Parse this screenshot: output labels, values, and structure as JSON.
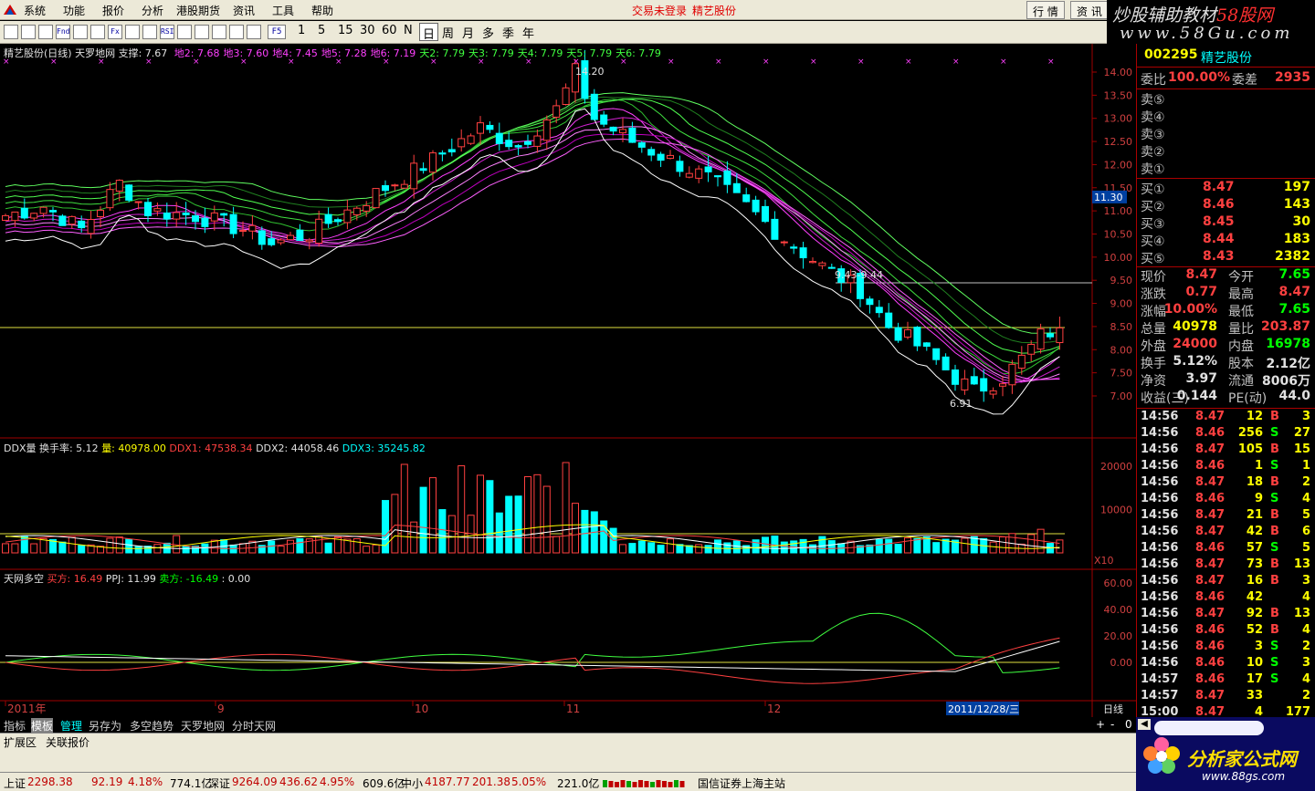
{
  "menu": {
    "items": [
      "系统",
      "功能",
      "报价",
      "分析",
      "港股期货",
      "资讯",
      "工具",
      "帮助"
    ],
    "trade_status": "交易未登录",
    "stock_name": "精艺股份",
    "right_buttons": [
      "行 情",
      "资 讯"
    ]
  },
  "brand_top": {
    "line1_a": "炒股辅助教材",
    "line1_b": "58股网",
    "line2": "www.58Gu.com"
  },
  "toolbar": {
    "icons": [
      "kline-tool-icon",
      "line-tool-icon",
      "chart-tool-icon",
      "fund-icon",
      "info-icon",
      "bars-icon",
      "fx-icon",
      "grid-icon",
      "sort-icon",
      "rsi-icon",
      "target-icon",
      "cursor-icon",
      "move-icon",
      "refresh-icon",
      "zoom-icon"
    ],
    "icon_labels": [
      "",
      "",
      "",
      "Fnd",
      "",
      "",
      "Fx",
      "",
      "",
      "RSI",
      "",
      "",
      "",
      "",
      ""
    ],
    "f5": "F5",
    "periods": [
      "1",
      "5",
      "15",
      "30",
      "60",
      "N",
      "日",
      "周",
      "月",
      "多",
      "季",
      "年"
    ],
    "active_period": "日"
  },
  "main_chart": {
    "header_title": "精艺股份(日线)",
    "indicator_name": "天罗地网",
    "support_label": "支撑: 7.67",
    "lines": [
      {
        "label": "地2: 7.68",
        "color": "#ff40ff"
      },
      {
        "label": "地3: 7.60",
        "color": "#ff40ff"
      },
      {
        "label": "地4: 7.45",
        "color": "#ff40ff"
      },
      {
        "label": "地5: 7.28",
        "color": "#ff40ff"
      },
      {
        "label": "地6: 7.19",
        "color": "#ff40ff"
      },
      {
        "label": "天2: 7.79",
        "color": "#40ff40"
      },
      {
        "label": "天3: 7.79",
        "color": "#40ff40"
      },
      {
        "label": "天4: 7.79",
        "color": "#40ff40"
      },
      {
        "label": "天5: 7.79",
        "color": "#40ff40"
      },
      {
        "label": "天6: 7.79",
        "color": "#40ff40"
      }
    ],
    "high_annotation": "14.20",
    "low_annotation": "6.91",
    "range_annotation": "9.43-9.44",
    "price_ticks": [
      "14.00",
      "13.50",
      "13.00",
      "12.50",
      "12.00",
      "11.50",
      "11.00",
      "10.50",
      "10.00",
      "9.50",
      "9.00",
      "8.50",
      "8.00",
      "7.50",
      "7.00"
    ],
    "current_price_tag": "11.30"
  },
  "volume_chart": {
    "name": "DDX量",
    "turnover": "换手率: 5.12",
    "volume": "量: 40978.00",
    "ddx1": "DDX1: 47538.34",
    "ddx2": "DDX2: 44058.46",
    "ddx3": "DDX3: 35245.82",
    "ticks": [
      "20000",
      "10000"
    ],
    "unit": "X10"
  },
  "osc_chart": {
    "name": "天网多空",
    "buy": "买方: 16.49",
    "ppj": "PPJ: 11.99",
    "sell": "卖方: -16.49",
    "tail": ": 0.00",
    "ticks": [
      "60.00",
      "40.00",
      "20.00",
      "0.00"
    ]
  },
  "date_axis": {
    "labels": [
      "2011年",
      "9",
      "10",
      "11",
      "12"
    ],
    "cursor_date": "2011/12/28/三",
    "period_label": "日线"
  },
  "right_panel": {
    "code": "002295",
    "name": "精艺股份",
    "weibi_label": "委比",
    "weibi_value": "100.00%",
    "weicha_label": "委差",
    "weicha_value": "2935",
    "sells": [
      {
        "label": "卖⑤",
        "price": "",
        "vol": ""
      },
      {
        "label": "卖④",
        "price": "",
        "vol": ""
      },
      {
        "label": "卖③",
        "price": "",
        "vol": ""
      },
      {
        "label": "卖②",
        "price": "",
        "vol": ""
      },
      {
        "label": "卖①",
        "price": "",
        "vol": ""
      }
    ],
    "buys": [
      {
        "label": "买①",
        "price": "8.47",
        "vol": "197"
      },
      {
        "label": "买②",
        "price": "8.46",
        "vol": "143"
      },
      {
        "label": "买③",
        "price": "8.45",
        "vol": "30"
      },
      {
        "label": "买④",
        "price": "8.44",
        "vol": "183"
      },
      {
        "label": "买⑤",
        "price": "8.43",
        "vol": "2382"
      }
    ],
    "stats": [
      {
        "l1": "现价",
        "v1": "8.47",
        "c1": "up",
        "l2": "今开",
        "v2": "7.65",
        "c2": "dn"
      },
      {
        "l1": "涨跌",
        "v1": "0.77",
        "c1": "up",
        "l2": "最高",
        "v2": "8.47",
        "c2": "up"
      },
      {
        "l1": "涨幅",
        "v1": "10.00%",
        "c1": "up",
        "l2": "最低",
        "v2": "7.65",
        "c2": "dn"
      },
      {
        "l1": "总量",
        "v1": "40978",
        "c1": "yel",
        "l2": "量比",
        "v2": "203.87",
        "c2": "up"
      },
      {
        "l1": "外盘",
        "v1": "24000",
        "c1": "up",
        "l2": "内盘",
        "v2": "16978",
        "c2": "dn"
      },
      {
        "l1": "换手",
        "v1": "5.12%",
        "c1": "wht",
        "l2": "股本",
        "v2": "2.12亿",
        "c2": "wht"
      },
      {
        "l1": "净资",
        "v1": "3.97",
        "c1": "wht",
        "l2": "流通",
        "v2": "8006万",
        "c2": "wht"
      },
      {
        "l1": "收益(三)",
        "v1": "0.144",
        "c1": "wht",
        "l2": "PE(动)",
        "v2": "44.0",
        "c2": "wht"
      }
    ],
    "ticks": [
      {
        "time": "14:56",
        "price": "8.47",
        "vol": "12",
        "side": "B",
        "n": "3"
      },
      {
        "time": "14:56",
        "price": "8.46",
        "vol": "256",
        "side": "S",
        "n": "27"
      },
      {
        "time": "14:56",
        "price": "8.47",
        "vol": "105",
        "side": "B",
        "n": "15"
      },
      {
        "time": "14:56",
        "price": "8.46",
        "vol": "1",
        "side": "S",
        "n": "1"
      },
      {
        "time": "14:56",
        "price": "8.47",
        "vol": "18",
        "side": "B",
        "n": "2"
      },
      {
        "time": "14:56",
        "price": "8.46",
        "vol": "9",
        "side": "S",
        "n": "4"
      },
      {
        "time": "14:56",
        "price": "8.47",
        "vol": "21",
        "side": "B",
        "n": "5"
      },
      {
        "time": "14:56",
        "price": "8.47",
        "vol": "42",
        "side": "B",
        "n": "6"
      },
      {
        "time": "14:56",
        "price": "8.46",
        "vol": "57",
        "side": "S",
        "n": "5"
      },
      {
        "time": "14:56",
        "price": "8.47",
        "vol": "73",
        "side": "B",
        "n": "13"
      },
      {
        "time": "14:56",
        "price": "8.47",
        "vol": "16",
        "side": "B",
        "n": "3"
      },
      {
        "time": "14:56",
        "price": "8.46",
        "vol": "42",
        "side": "",
        "n": "4"
      },
      {
        "time": "14:56",
        "price": "8.47",
        "vol": "92",
        "side": "B",
        "n": "13"
      },
      {
        "time": "14:56",
        "price": "8.46",
        "vol": "52",
        "side": "B",
        "n": "4"
      },
      {
        "time": "14:56",
        "price": "8.46",
        "vol": "3",
        "side": "S",
        "n": "2"
      },
      {
        "time": "14:56",
        "price": "8.46",
        "vol": "10",
        "side": "S",
        "n": "3"
      },
      {
        "time": "14:57",
        "price": "8.46",
        "vol": "17",
        "side": "S",
        "n": "4"
      },
      {
        "time": "14:57",
        "price": "8.47",
        "vol": "33",
        "side": "",
        "n": "2"
      },
      {
        "time": "15:00",
        "price": "8.47",
        "vol": "4",
        "side": "",
        "n": "177"
      }
    ]
  },
  "indicator_tabs": [
    "指标",
    "模板",
    "管理",
    "另存为",
    "多空趋势",
    "天罗地网",
    "分时天网"
  ],
  "bottom_tabs": [
    "扩展区",
    "关联报价"
  ],
  "statusbar": {
    "sh_label": "上证",
    "sh_index": "2298.38",
    "sh_change": "92.19",
    "sh_pct": "4.18%",
    "sh_amount": "774.1亿",
    "sz_label": "深证",
    "sz_index": "9264.09",
    "sz_change": "436.62",
    "sz_pct": "4.95%",
    "sz_amount": "609.6亿",
    "zx_label": "中小",
    "zx_index": "4187.77",
    "zx_change": "201.38",
    "zx_pct": "5.05%",
    "zx_amount": "221.0亿",
    "server": "国信证券上海主站"
  },
  "brand_bottom": {
    "title": "分析家公式网",
    "url": "www.88gs.com"
  }
}
